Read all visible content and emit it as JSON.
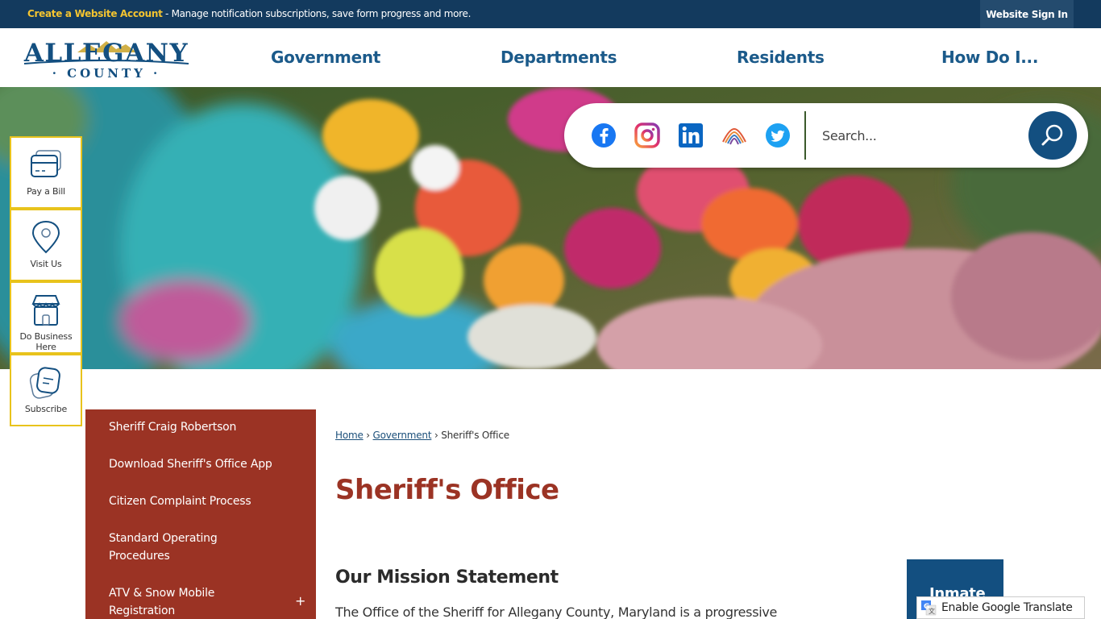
{
  "topbar": {
    "cta": "Create a Website Account",
    "message": " - Manage notification subscriptions, save form progress and more.",
    "signin_label": "Website Sign In"
  },
  "logo": {
    "line1": "ALLEGANY",
    "line2": "· COUNTY ·"
  },
  "nav": [
    {
      "label": "Government"
    },
    {
      "label": "Departments"
    },
    {
      "label": "Residents"
    },
    {
      "label": "How Do I..."
    }
  ],
  "social": [
    {
      "name": "facebook-icon"
    },
    {
      "name": "instagram-icon"
    },
    {
      "name": "linkedin-icon"
    },
    {
      "name": "county-app-icon"
    },
    {
      "name": "twitter-icon"
    }
  ],
  "search": {
    "placeholder": "Search..."
  },
  "quick_links": [
    {
      "label": "Pay a Bill"
    },
    {
      "label": "Visit Us"
    },
    {
      "label": "Do Business Here"
    },
    {
      "label": "Subscribe"
    }
  ],
  "side_menu": [
    {
      "label": "Sheriff Craig Robertson"
    },
    {
      "label": "Download Sheriff's Office App"
    },
    {
      "label": "Citizen Complaint Process"
    },
    {
      "label": "Standard Operating Procedures"
    },
    {
      "label": "ATV & Snow Mobile Registration"
    }
  ],
  "side_menu_expand": "+",
  "breadcrumb": {
    "home": "Home",
    "sep": "›",
    "government": "Government",
    "current": "Sheriff's Office"
  },
  "page": {
    "title": "Sheriff's Office",
    "section_title": "Our Mission Statement",
    "mission_text": "The Office of the Sheriff for Allegany County, Maryland is a progressive"
  },
  "inmate_button": "Inmate",
  "translate_label": "Enable Google Translate",
  "colors": {
    "topbar": "#133a5e",
    "cta_yellow": "#f4c430",
    "nav_blue": "#1b5a8a",
    "brand_red": "#9b3324",
    "quick_border": "#e8c31c",
    "search_button": "#134f80"
  }
}
